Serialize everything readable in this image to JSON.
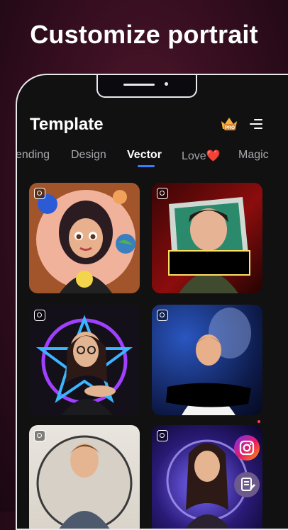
{
  "headline": "Customize portrait",
  "app": {
    "title": "Template"
  },
  "header": {
    "pro_icon": "crown-pro-icon",
    "menu_icon": "menu-icon"
  },
  "tabs": [
    {
      "label": "ending",
      "active": false
    },
    {
      "label": "Design",
      "active": false
    },
    {
      "label": "Vector",
      "active": true
    },
    {
      "label": "Love❤️",
      "active": false
    },
    {
      "label": "Magic",
      "active": false
    }
  ],
  "cards": [
    {
      "name": "vector-card-girl-cartoon"
    },
    {
      "name": "vector-card-boy-frame"
    },
    {
      "name": "vector-card-neon-star"
    },
    {
      "name": "vector-card-boy-blue"
    },
    {
      "name": "vector-card-boy-circle"
    },
    {
      "name": "vector-card-girl-energy"
    }
  ],
  "fab": {
    "instagram_icon": "instagram-icon",
    "note_icon": "note-icon"
  },
  "colors": {
    "accent": "#3b7cff",
    "crown": "#f4b23a"
  }
}
